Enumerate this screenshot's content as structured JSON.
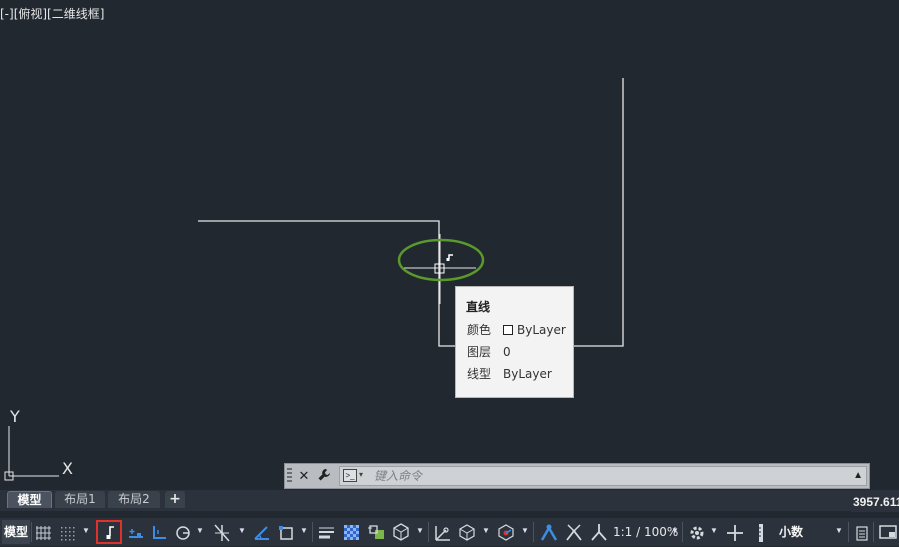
{
  "viewport": {
    "view_label": "[-][俯视][二维线框]",
    "ucs": {
      "x_label": "X",
      "y_label": "Y"
    }
  },
  "tooltip": {
    "title": "直线",
    "rows": [
      {
        "key": "颜色",
        "value": "ByLayer",
        "has_swatch": true
      },
      {
        "key": "图层",
        "value": "0"
      },
      {
        "key": "线型",
        "value": "ByLayer"
      }
    ]
  },
  "command_line": {
    "close_icon": "close-icon",
    "settings_icon": "wrench-icon",
    "placeholder": "键入命令"
  },
  "layout_tabs": [
    {
      "label": "模型",
      "active": true
    },
    {
      "label": "布局1",
      "active": false
    },
    {
      "label": "布局2",
      "active": false
    }
  ],
  "add_tab_label": "+",
  "coordinates": "3957.611",
  "status_bar": {
    "model_label": "模型",
    "scale_label": "1:1 / 100%",
    "units_label": "小数",
    "highlighted_icon": "object-snap-tracking-icon",
    "highlight_color": "#e0322d",
    "accent_color": "#3d8de6"
  },
  "annotation": {
    "ellipse_color": "#5a9a2c"
  }
}
